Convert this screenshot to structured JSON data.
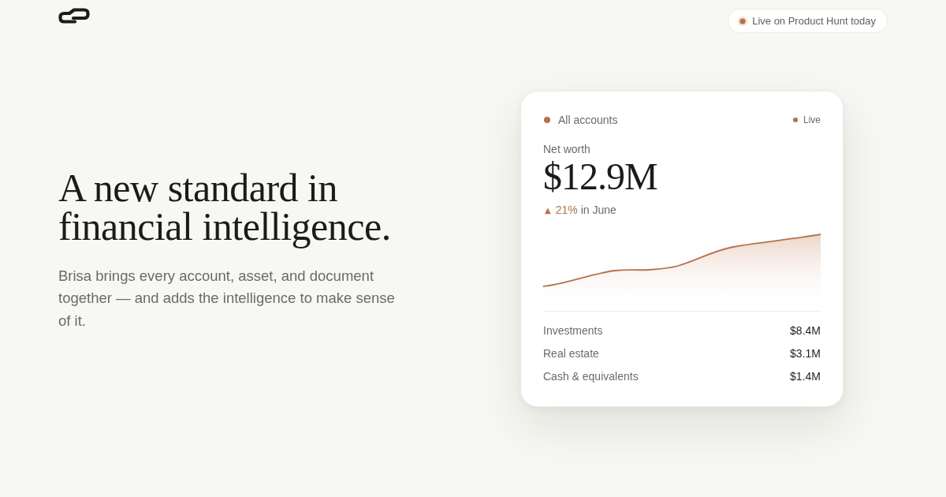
{
  "badge": {
    "label": "Live on Product Hunt today"
  },
  "hero": {
    "title": "A new standard in financial intelligence.",
    "description": "Brisa brings every account, asset, and document together — and adds the intelligence to make sense of it."
  },
  "card": {
    "scope": "All accounts",
    "status": "Live",
    "metric_label": "Net worth",
    "metric_value": "$12.9M",
    "change": {
      "arrow": "▲",
      "value": "21%",
      "period": "in June"
    },
    "breakdown": [
      {
        "label": "Investments",
        "value": "$8.4M"
      },
      {
        "label": "Real estate",
        "value": "$3.1M"
      },
      {
        "label": "Cash & equivalents",
        "value": "$1.4M"
      }
    ]
  }
}
